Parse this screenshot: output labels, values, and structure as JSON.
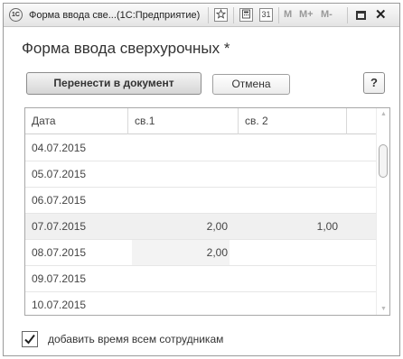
{
  "window": {
    "title": "Форма ввода све...",
    "app": "(1С:Предприятие)",
    "logo_text": "1С",
    "toolbar": {
      "favorite_icon": "star-icon",
      "calc_icon": "calculator-icon",
      "calendar_icon": "calendar-icon",
      "calendar_text": "31",
      "m_label": "M",
      "m_plus_label": "M+",
      "m_minus_label": "M-",
      "close_glyph": "✕"
    }
  },
  "form": {
    "title": "Форма ввода сверхурочных *",
    "buttons": {
      "transfer": "Перенести в документ",
      "cancel": "Отмена",
      "help": "?"
    }
  },
  "table": {
    "columns": [
      "Дата",
      "св.1",
      "св. 2"
    ],
    "rows": [
      {
        "date": "04.07.2015",
        "sv1": "",
        "sv2": ""
      },
      {
        "date": "05.07.2015",
        "sv1": "",
        "sv2": ""
      },
      {
        "date": "06.07.2015",
        "sv1": "",
        "sv2": ""
      },
      {
        "date": "07.07.2015",
        "sv1": "2,00",
        "sv2": "1,00"
      },
      {
        "date": "08.07.2015",
        "sv1": "2,00",
        "sv2": ""
      },
      {
        "date": "09.07.2015",
        "sv1": "",
        "sv2": ""
      },
      {
        "date": "10.07.2015",
        "sv1": "",
        "sv2": ""
      }
    ]
  },
  "option": {
    "label": "добавить время всем сотрудникам",
    "checked": true
  }
}
